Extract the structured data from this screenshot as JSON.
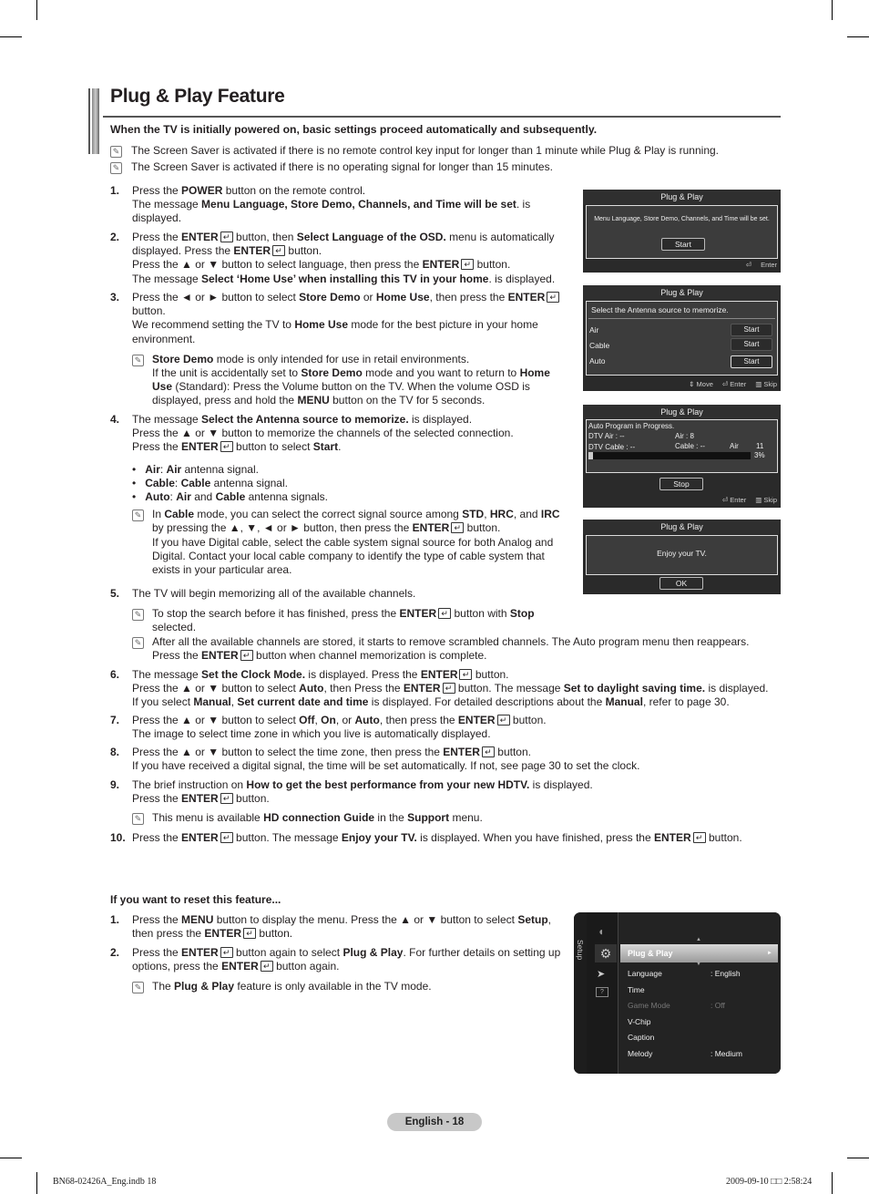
{
  "title": "Plug & Play Feature",
  "intro": "When the TV is initially powered on, basic settings proceed automatically and subsequently.",
  "intro_notes": [
    "The Screen Saver is activated if there is no remote control key input for longer than 1 minute while Plug & Play is running.",
    "The Screen Saver is activated if there is no operating signal for longer than 15 minutes."
  ],
  "steps": {
    "s1": {
      "num": "1.",
      "l1a": "Press the ",
      "l1b": "POWER",
      "l1c": " button on the remote control.",
      "l2a": "The message ",
      "l2b": "Menu Language, Store Demo, Channels, and Time will be set",
      "l2c": ". is displayed."
    },
    "s2": {
      "num": "2.",
      "a": "Press the ",
      "b": "ENTER",
      "c": " button, then ",
      "d": "Select Language of the OSD.",
      "e": " menu is automatically displayed. Press the ",
      "f": "ENTER",
      "g": " button.",
      "h": "Press the ▲ or ▼ button to select language, then press the ",
      "i": "ENTER",
      "j": " button.",
      "k": "The message ",
      "l": "Select ‘Home Use’ when installing this TV in your home",
      "m": ". is displayed."
    },
    "s3": {
      "num": "3.",
      "a": "Press the ◄ or ► button to select ",
      "b": "Store Demo",
      "c": " or ",
      "d": "Home Use",
      "e": ", then press the ",
      "f": "ENTER",
      "g": " button.",
      "h": "We recommend setting the TV to ",
      "i": "Home Use",
      "j": " mode for the best picture in your home environment.",
      "note": {
        "a": "Store Demo",
        "b": " mode is only intended for use in retail environments.",
        "c": "If the unit is accidentally set to ",
        "d": "Store Demo",
        "e": " mode and you want to return to ",
        "f": "Home Use",
        "g": " (Standard): Press the Volume button on the TV. When the volume OSD is displayed, press and hold the ",
        "h": "MENU",
        "i": " button on the TV for 5 seconds."
      }
    },
    "s4": {
      "num": "4.",
      "a": "The message ",
      "b": "Select the Antenna source to memorize.",
      "c": " is displayed.",
      "d": "Press the ▲ or ▼ button to memorize the channels of the selected connection.",
      "e": "Press the ",
      "f": "ENTER",
      "g": " button to select ",
      "h": "Start",
      "i": ".",
      "bullets": [
        {
          "k": "Air",
          "sep": ": ",
          "v1": "Air",
          "v2": " antenna signal."
        },
        {
          "k": "Cable",
          "sep": ": ",
          "v1": "Cable",
          "v2": " antenna signal."
        },
        {
          "k": "Auto",
          "sep": ": ",
          "v1": "Air",
          "v2": " and ",
          "v3": "Cable",
          "v4": " antenna signals."
        }
      ],
      "note": {
        "a": "In ",
        "b": "Cable",
        "c": " mode, you can select the correct signal source among ",
        "d": "STD",
        "e": ", ",
        "f": "HRC",
        "g": ", and ",
        "h": "IRC",
        "i": " by pressing the ▲, ▼, ◄ or ► button, then press the ",
        "j": "ENTER",
        "k": " button.",
        "l": "If you have Digital cable, select the cable system signal source for both Analog and Digital. Contact your local cable company to identify the type of cable system that exists in your particular area."
      }
    },
    "s5": {
      "num": "5.",
      "a": "The TV will begin memorizing all of the available channels.",
      "note1": {
        "a": "To stop the search before it has finished, press the ",
        "b": "ENTER",
        "c": " button with ",
        "d": "Stop",
        "e": " selected."
      },
      "note2": {
        "a": "After all the available channels are stored, it starts to remove scrambled channels. The Auto program menu then reappears.",
        "b": "Press the ",
        "c": "ENTER",
        "d": " button when channel memorization is complete."
      }
    },
    "s6": {
      "num": "6.",
      "a": "The message ",
      "b": "Set the Clock Mode.",
      "c": " is displayed. Press the ",
      "d": "ENTER",
      "e": " button.",
      "f": "Press the ▲ or ▼ button to select ",
      "g": "Auto",
      "h": ", then Press the ",
      "i": "ENTER",
      "j": " button. The message ",
      "k": "Set to daylight saving time.",
      "l": " is displayed.",
      "m": "If you select ",
      "n": "Manual",
      "o": ", ",
      "p": "Set current date and time",
      "q": " is displayed. For detailed descriptions about the ",
      "r": "Manual",
      "s": ", refer to page 30."
    },
    "s7": {
      "num": "7.",
      "a": "Press the ▲ or ▼ button to select ",
      "b": "Off",
      "c": ", ",
      "d": "On",
      "e": ", or ",
      "f": "Auto",
      "g": ", then press the ",
      "h": "ENTER",
      "i": " button.",
      "j": "The image to select time zone in which you live is automatically displayed."
    },
    "s8": {
      "num": "8.",
      "a": "Press the ▲ or ▼ button to select the time zone, then press the ",
      "b": "ENTER",
      "c": " button.",
      "d": "If you have received a digital signal, the time will be set automatically. If not, see page 30 to set the clock."
    },
    "s9": {
      "num": "9.",
      "a": "The brief instruction on ",
      "b": "How to get the best performance from your new HDTV.",
      "c": " is displayed.",
      "d": "Press the ",
      "e": "ENTER",
      "f": " button.",
      "note": {
        "a": "This menu is available ",
        "b": "HD connection Guide",
        "c": " in the ",
        "d": "Support",
        "e": " menu."
      }
    },
    "s10": {
      "num": "10.",
      "a": "Press the ",
      "b": "ENTER",
      "c": " button. The message ",
      "d": "Enjoy your TV.",
      "e": " is displayed. When you have finished, press the ",
      "f": "ENTER",
      "g": " button."
    }
  },
  "reset": {
    "heading": "If you want to reset this feature...",
    "r1": {
      "num": "1.",
      "a": "Press the ",
      "b": "MENU",
      "c": " button to display the menu. Press the ▲ or ▼ button to select ",
      "d": "Setup",
      "e": ",",
      "f": "then press the ",
      "g": "ENTER",
      "h": " button."
    },
    "r2": {
      "num": "2.",
      "a": "Press the ",
      "b": "ENTER",
      "c": " button again to select ",
      "d": "Plug & Play",
      "e": ". For further details on setting up options, press the ",
      "f": "ENTER",
      "g": " button again."
    },
    "note": {
      "a": "The ",
      "b": "Plug & Play",
      "c": " feature is only available in the TV mode."
    }
  },
  "osd1": {
    "title": "Plug & Play",
    "message": "Menu Language, Store Demo, Channels, and Time will be set.",
    "button": "Start",
    "footer_enter": "Enter"
  },
  "osd2": {
    "title": "Plug & Play",
    "message": "Select the Antenna source to memorize.",
    "rows": [
      {
        "label": "Air",
        "button": "Start"
      },
      {
        "label": "Cable",
        "button": "Start"
      },
      {
        "label": "Auto",
        "button": "Start"
      }
    ],
    "footer": {
      "move": "Move",
      "enter": "Enter",
      "skip": "Skip"
    }
  },
  "osd3": {
    "title": "Plug & Play",
    "status": "Auto Program in Progress.",
    "dtv_air": "DTV Air : --",
    "air": "Air : 8",
    "dtv_cable": "DTV Cable : --",
    "cable": "Cable : --",
    "source": "Air",
    "channel": "11",
    "percent_label": "3%",
    "progress": 0.03,
    "button": "Stop",
    "footer": {
      "enter": "Enter",
      "skip": "Skip"
    }
  },
  "osd4": {
    "title": "Plug & Play",
    "message": "Enjoy your TV.",
    "button": "OK"
  },
  "setup_menu": {
    "side_label": "Setup",
    "selected": "Plug & Play",
    "items": [
      {
        "label": "Language",
        "value": ": English",
        "disabled": false
      },
      {
        "label": "Time",
        "value": "",
        "disabled": false
      },
      {
        "label": "Game Mode",
        "value": ": Off",
        "disabled": true
      },
      {
        "label": "V-Chip",
        "value": "",
        "disabled": false
      },
      {
        "label": "Caption",
        "value": "",
        "disabled": false
      },
      {
        "label": "Melody",
        "value": ": Medium",
        "disabled": false
      }
    ]
  },
  "footer": {
    "page": "English - 18",
    "file": "BN68-02426A_Eng.indb   18",
    "timestamp": "2009-09-10   □□ 2:58:24"
  }
}
